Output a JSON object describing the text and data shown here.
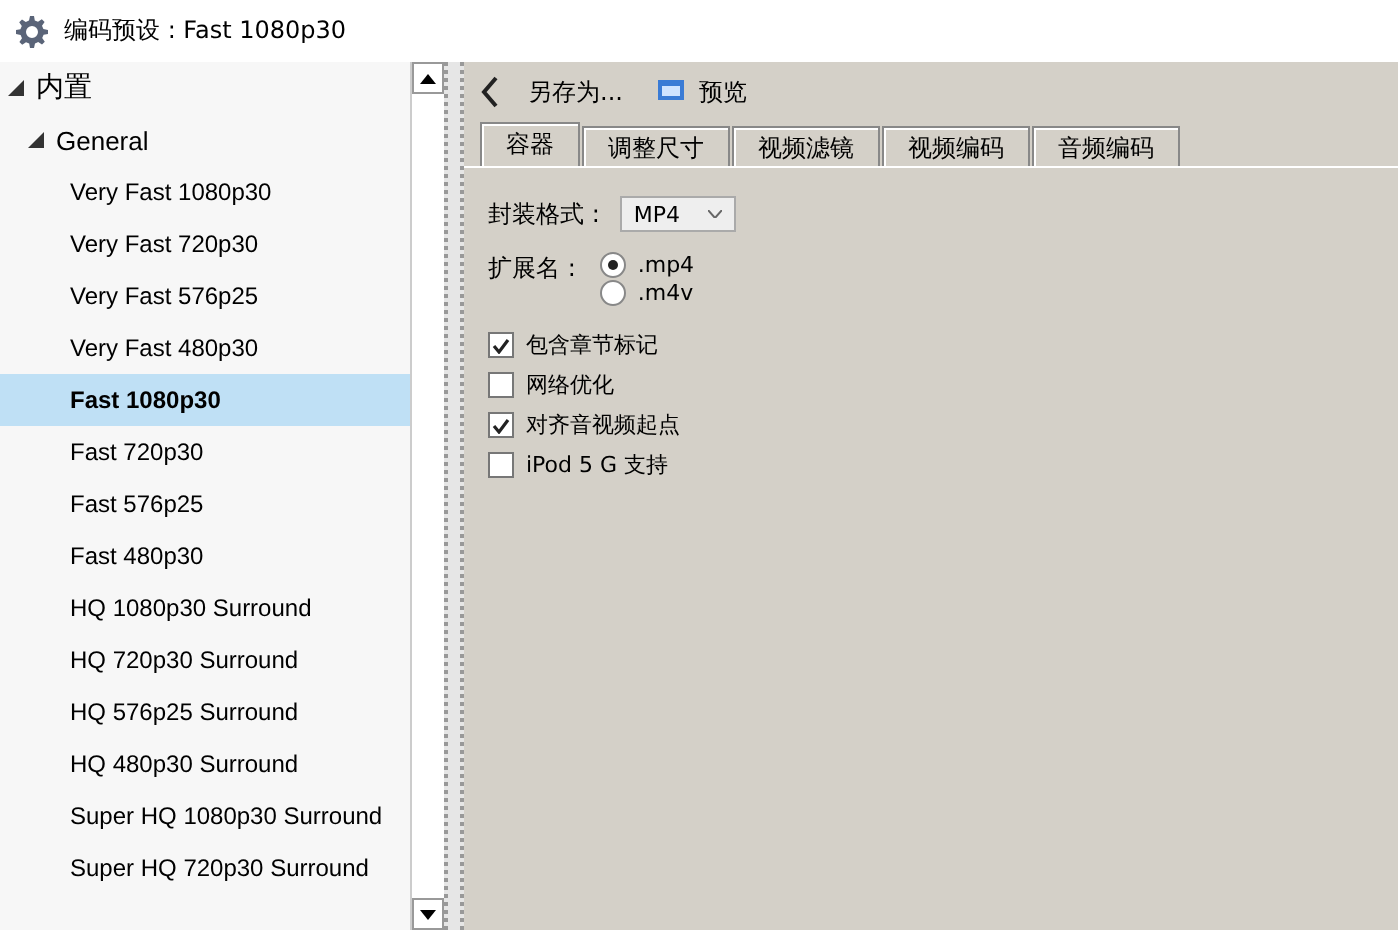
{
  "window": {
    "title": "编码预设 : Fast 1080p30"
  },
  "tree": [
    {
      "label": "内置",
      "expanded": true,
      "selected": false,
      "children": [
        {
          "label": "General",
          "expanded": true,
          "selected": false,
          "children": [
            {
              "label": "Very Fast 1080p30",
              "selected": false
            },
            {
              "label": "Very Fast 720p30",
              "selected": false
            },
            {
              "label": "Very Fast 576p25",
              "selected": false
            },
            {
              "label": "Very Fast 480p30",
              "selected": false
            },
            {
              "label": "Fast 1080p30",
              "selected": true
            },
            {
              "label": "Fast 720p30",
              "selected": false
            },
            {
              "label": "Fast 576p25",
              "selected": false
            },
            {
              "label": "Fast 480p30",
              "selected": false
            },
            {
              "label": "HQ 1080p30 Surround",
              "selected": false
            },
            {
              "label": "HQ 720p30 Surround",
              "selected": false
            },
            {
              "label": "HQ 576p25 Surround",
              "selected": false
            },
            {
              "label": "HQ 480p30 Surround",
              "selected": false
            },
            {
              "label": "Super HQ 1080p30 Surround",
              "selected": false
            },
            {
              "label": "Super HQ 720p30 Surround",
              "selected": false
            }
          ]
        }
      ]
    }
  ],
  "toolbar": {
    "save_as": "另存为...",
    "preview": "预览"
  },
  "tabs": [
    {
      "label": "容器",
      "selected": true
    },
    {
      "label": "调整尺寸",
      "selected": false
    },
    {
      "label": "视频滤镜",
      "selected": false
    },
    {
      "label": "视频编码",
      "selected": false
    },
    {
      "label": "音频编码",
      "selected": false
    }
  ],
  "format": {
    "label": "封装格式 :",
    "value": "MP4"
  },
  "extension": {
    "label": "扩展名 :",
    "options": [
      {
        "label": ".mp4",
        "selected": true
      },
      {
        "label": ".m4v",
        "selected": false
      }
    ]
  },
  "options": [
    {
      "label": "包含章节标记",
      "checked": true
    },
    {
      "label": "网络优化",
      "checked": false
    },
    {
      "label": "对齐音视频起点",
      "checked": true
    },
    {
      "label": "iPod 5 G 支持",
      "checked": false
    }
  ]
}
